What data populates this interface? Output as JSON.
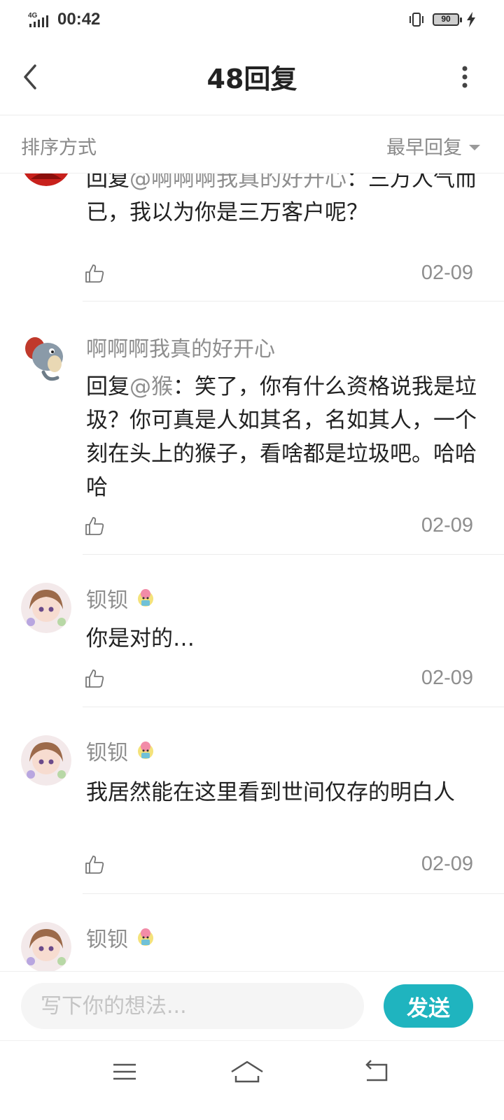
{
  "status_bar": {
    "network": "4G",
    "time": "00:42",
    "battery": "90"
  },
  "header": {
    "title": "48回复"
  },
  "sort": {
    "label": "排序方式",
    "selected": "最早回复"
  },
  "replies": [
    {
      "username": "",
      "avatar": "red-avatar",
      "prefix": "回复",
      "mention": "@啊啊啊我真的好开心",
      "text": "：三万人气而已，我以为你是三万客户呢？",
      "date": "02-09"
    },
    {
      "username": "啊啊啊我真的好开心",
      "avatar": "cartoon-elephant-avatar",
      "prefix": "回复",
      "mention": "@猴",
      "text": "：笑了，你有什么资格说我是垃圾？你可真是人如其名，名如其人，一个刻在头上的猴子，看啥都是垃圾吧。哈哈哈",
      "date": "02-09"
    },
    {
      "username": "钡钡",
      "avatar": "anime-girl-avatar",
      "badge": "level-badge-icon",
      "text": "你是对的…",
      "date": "02-09"
    },
    {
      "username": "钡钡",
      "avatar": "anime-girl-avatar",
      "badge": "level-badge-icon",
      "text": "我居然能在这里看到世间仅存的明白人",
      "date": "02-09"
    },
    {
      "username": "钡钡",
      "avatar": "anime-girl-avatar",
      "badge": "level-badge-icon",
      "text": "",
      "date": ""
    }
  ],
  "composer": {
    "placeholder": "写下你的想法...",
    "send_label": "发送"
  },
  "colors": {
    "accent": "#1fb4bf",
    "muted_text": "#8e8e8e",
    "primary_text": "#222222"
  }
}
